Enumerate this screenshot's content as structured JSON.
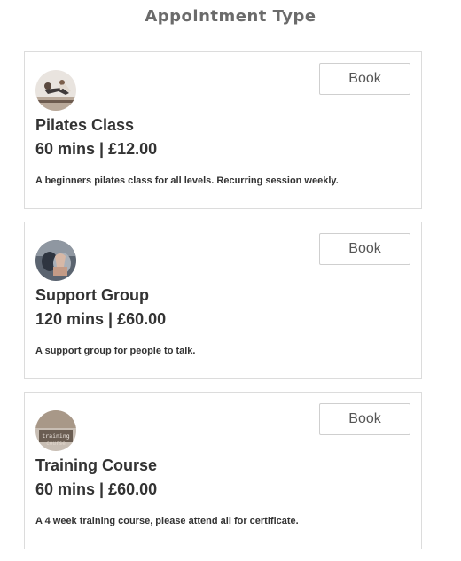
{
  "page": {
    "title": "Appointment Type"
  },
  "appointments": [
    {
      "name": "Pilates Class",
      "duration_price": "60 mins | £12.00",
      "description": "A beginners pilates class for all levels. Recurring session weekly.",
      "book_label": "Book",
      "image": "pilates-photo"
    },
    {
      "name": "Support Group",
      "duration_price": "120 mins | £60.00",
      "description": "A support group for people to talk.",
      "book_label": "Book",
      "image": "support-group-photo"
    },
    {
      "name": "Training Course",
      "duration_price": "60 mins | £60.00",
      "description": "A 4 week training course, please attend all for certificate.",
      "book_label": "Book",
      "image": "training-photo",
      "image_text": "training course"
    }
  ],
  "colors": {
    "title": "#6b6b6b",
    "text": "#333333",
    "border": "#dcdcdc"
  }
}
